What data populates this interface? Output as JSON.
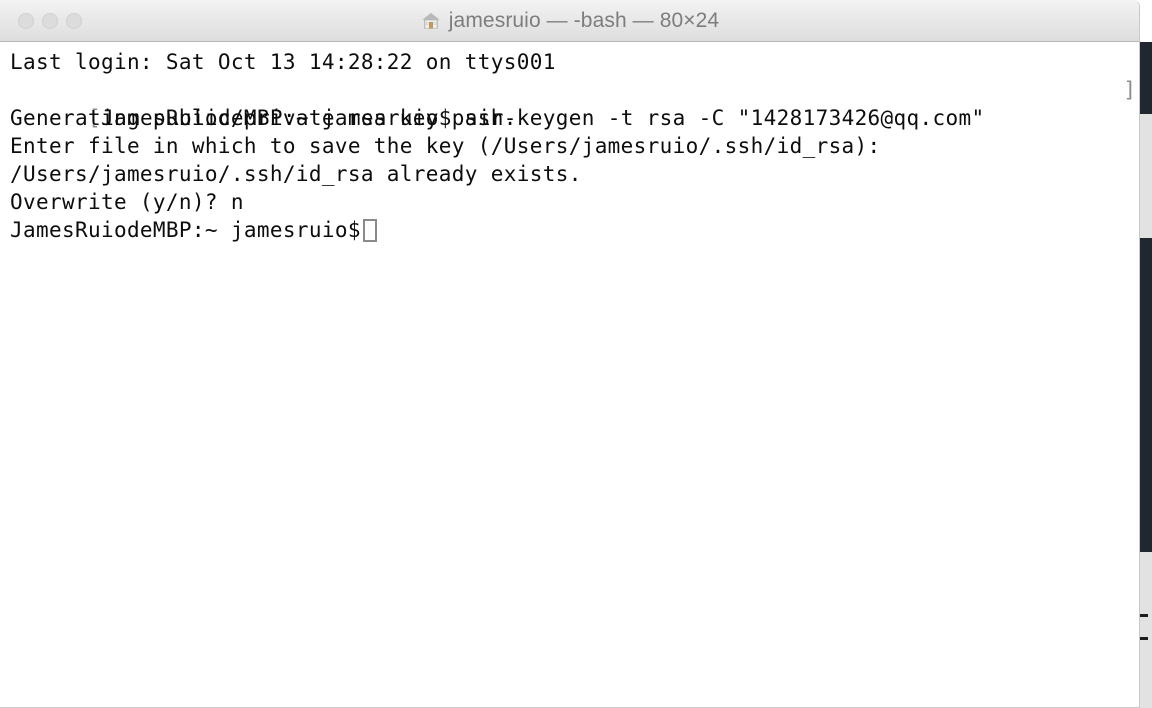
{
  "window": {
    "app": "Terminal",
    "title": "jamesruio — -bash — 80×24",
    "icon": "home-icon",
    "size_label": "80×24",
    "shell": "-bash",
    "user": "jamesruio",
    "focused": false,
    "traffic_lights": [
      {
        "name": "close",
        "label": "Close",
        "color": "#dcdcdc"
      },
      {
        "name": "minimize",
        "label": "Minimize",
        "color": "#dcdcdc"
      },
      {
        "name": "zoom",
        "label": "Zoom",
        "color": "#dcdcdc"
      }
    ]
  },
  "terminal": {
    "background": "#ffffff",
    "foreground": "#0d0d0d",
    "bracket_color": "#8c8c8c",
    "cursor": {
      "style": "hollow-block",
      "color": "#8a8a8a"
    },
    "lines": [
      {
        "text": "Last login: Sat Oct 13 14:28:22 on ttys001"
      },
      {
        "prefix_bracket": "[",
        "text": "JamesRuiodeMBP:~ jamesruio$ ssh-keygen -t rsa -C \"1428173426@qq.com\"",
        "suffix_bracket": "]"
      },
      {
        "text": "Generating public/private rsa key pair."
      },
      {
        "text": "Enter file in which to save the key (/Users/jamesruio/.ssh/id_rsa):"
      },
      {
        "text": "/Users/jamesruio/.ssh/id_rsa already exists."
      },
      {
        "text": "Overwrite (y/n)? n"
      }
    ],
    "prompt": "JamesRuiodeMBP:~ jamesruio$"
  },
  "background_window": {
    "description": "partially visible dark window behind terminal at right edge",
    "dark_color": "#21272e",
    "light_color": "#e2e2e2",
    "bracket_glyph": "]"
  }
}
